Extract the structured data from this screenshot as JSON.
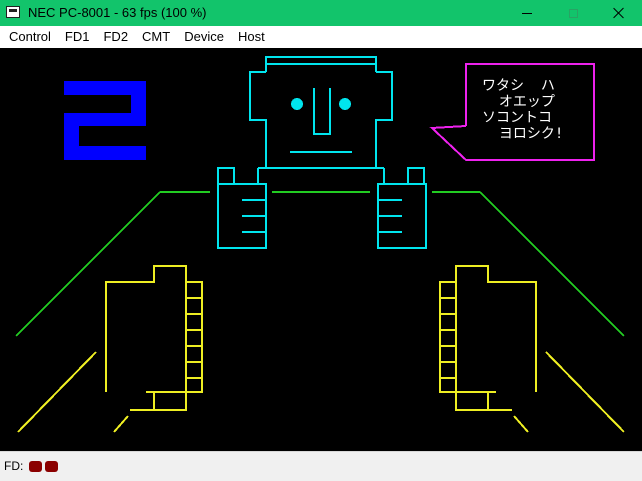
{
  "window": {
    "title": "NEC PC-8001 - 63 fps (100 %)"
  },
  "menu": {
    "items": [
      "Control",
      "FD1",
      "FD2",
      "CMT",
      "Device",
      "Host"
    ]
  },
  "screen": {
    "speech_lines": [
      "ワタシ  ハ",
      "  オエップ",
      "ソコントコ",
      "  ヨロシク!"
    ],
    "counter": "2",
    "colors": {
      "counter": "#0000ff",
      "robot": "#00e5ee",
      "floor": "#22cc22",
      "hands": "#eeee22",
      "bubble": "#ee22ee"
    }
  },
  "status": {
    "fd_label": "FD:",
    "fd_led_color": "#8b0000"
  }
}
